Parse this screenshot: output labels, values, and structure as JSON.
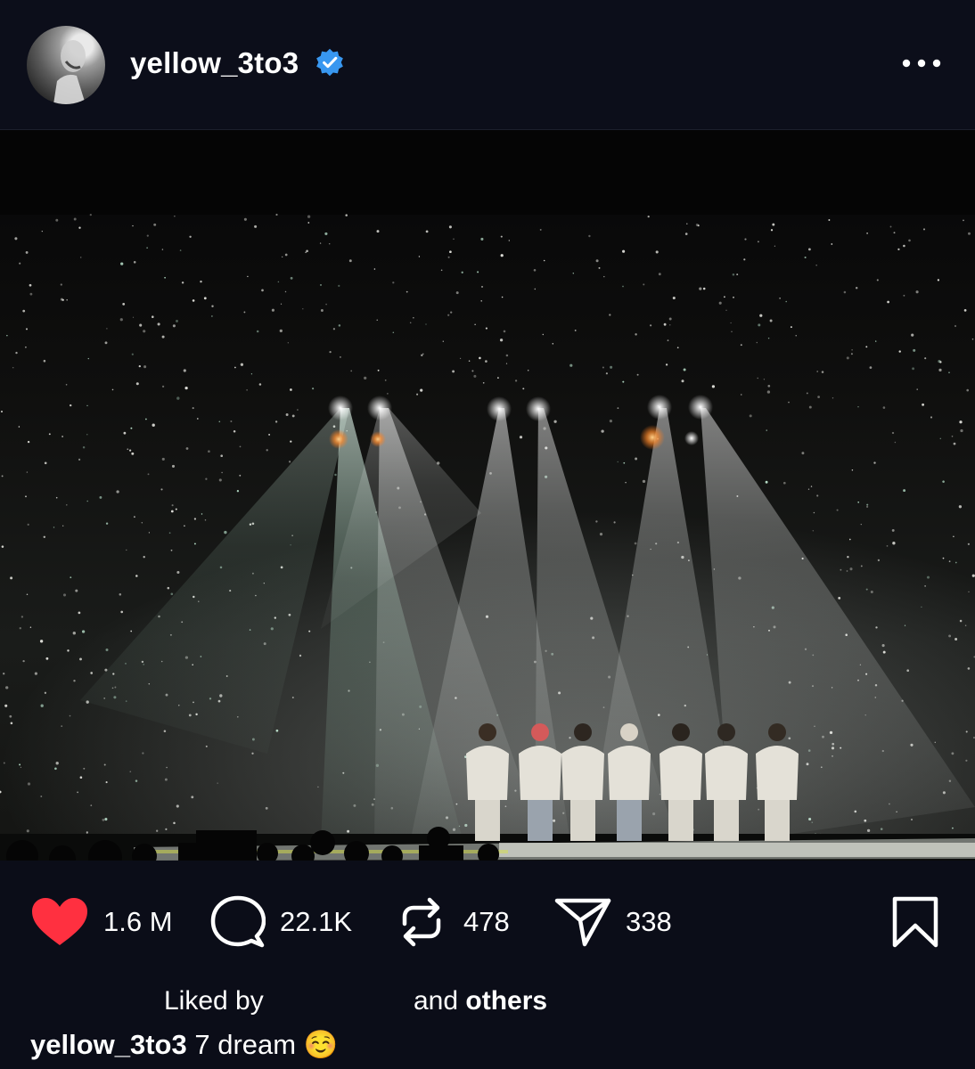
{
  "post": {
    "username": "yellow_3to3",
    "verified": true,
    "more_icon": "ellipsis-icon"
  },
  "actions": {
    "likes": {
      "icon": "heart-filled-icon",
      "count": "1.6 M",
      "color": "#ff3040"
    },
    "comments": {
      "icon": "comment-bubble-icon",
      "count": "22.1K"
    },
    "reposts": {
      "icon": "repost-icon",
      "count": "478"
    },
    "shares": {
      "icon": "send-icon",
      "count": "338"
    },
    "save": {
      "icon": "bookmark-icon"
    }
  },
  "liked_by": {
    "prefix": "Liked by",
    "middle": "and",
    "suffix": "others"
  },
  "caption": {
    "username": "yellow_3to3",
    "text": "7 dream ☺️"
  },
  "colors": {
    "background": "#0b0d18",
    "verified_badge": "#3897f0",
    "like": "#ff3040"
  }
}
